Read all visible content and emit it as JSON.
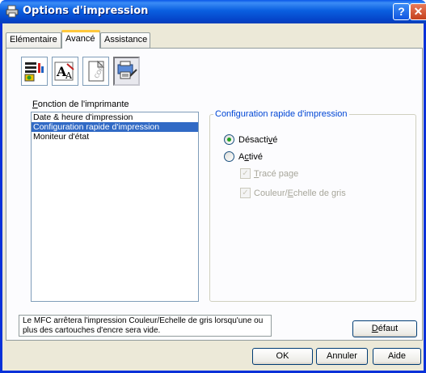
{
  "window": {
    "title": "Options d'impression",
    "help_button": "?",
    "close_button": "✕"
  },
  "tabs": [
    {
      "label": "Elémentaire"
    },
    {
      "label": "Avancé"
    },
    {
      "label": "Assistance"
    }
  ],
  "toolbar": {
    "icons": [
      "printer-settings-icon",
      "font-size-icon",
      "watermark-icon",
      "device-options-icon"
    ]
  },
  "function_list": {
    "label_prefix": "F",
    "label_rest": "onction de l'imprimante",
    "items": [
      {
        "label": "Date & heure d'impression"
      },
      {
        "label": "Configuration rapide d'impression"
      },
      {
        "label": "Moniteur d'état"
      }
    ]
  },
  "quick_config": {
    "group_title": "Configuration rapide d'impression",
    "off_label_a": "Désacti",
    "off_label_u": "v",
    "off_label_b": "é",
    "on_label_a": "A",
    "on_label_u": "c",
    "on_label_b": "tivé",
    "trace_u": "T",
    "trace_rest": "racé page",
    "color_a": "Couleur/",
    "color_u": "E",
    "color_b": "chelle de gris"
  },
  "status": {
    "text": "Le MFC arrêtera l'impression Couleur/Echelle de gris lorsqu'une ou plus des cartouches d'encre sera vide."
  },
  "buttons": {
    "default_u": "D",
    "default_rest": "éfaut",
    "ok": "OK",
    "cancel": "Annuler",
    "help": "Aide"
  },
  "colors": {
    "title_bar": "#0a5fe0",
    "selection": "#316ac5",
    "group_title": "#0046d5",
    "active_tab_accent": "#ffc83c",
    "radio_dot": "#21a121"
  }
}
